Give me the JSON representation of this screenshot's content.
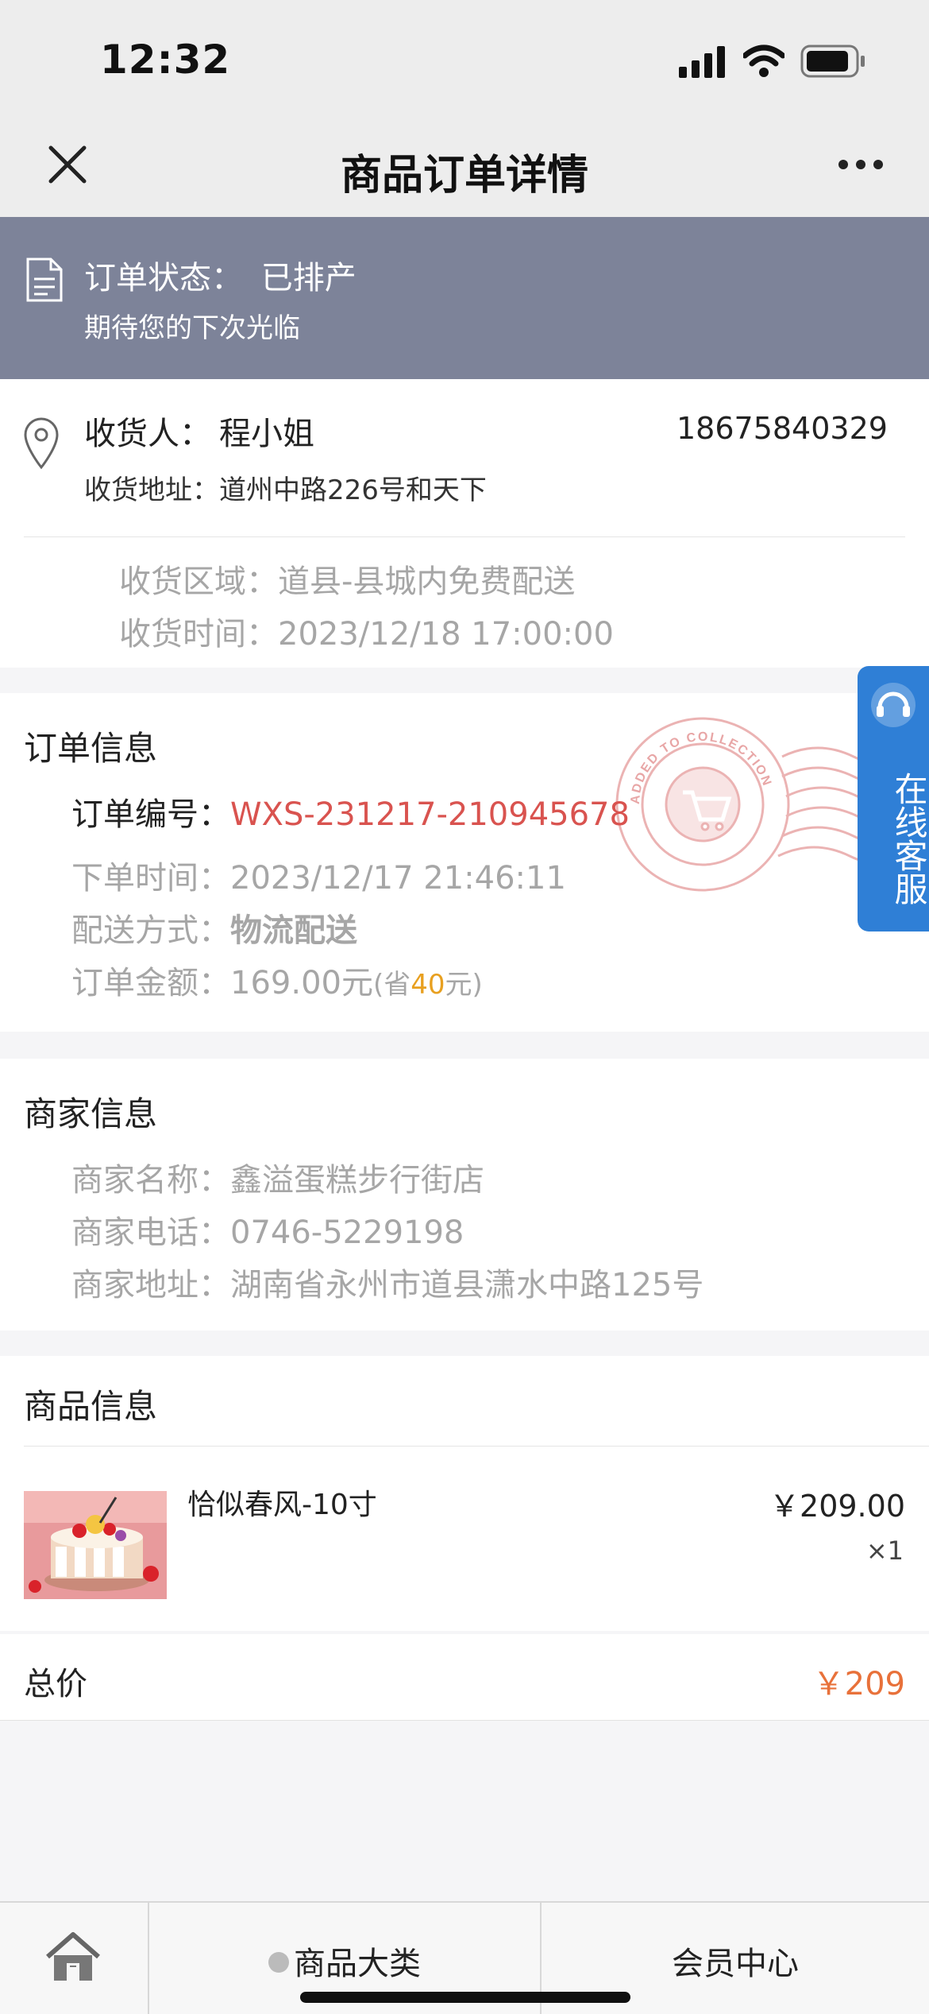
{
  "status_bar": {
    "time": "12:32"
  },
  "nav": {
    "title": "商品订单详情",
    "more": "•••"
  },
  "order_status": {
    "label": "订单状态：",
    "value": "已排产",
    "subtitle": "期待您的下次光临"
  },
  "recipient": {
    "name_label": "收货人：",
    "name": "程小姐",
    "phone": "18675840329",
    "address_label": "收货地址：",
    "address": "道州中路226号和天下",
    "area_label": "收货区域：",
    "area": "道县-县城内免费配送",
    "time_label": "收货时间：",
    "time": "2023/12/18 17:00:00"
  },
  "order_info": {
    "title": "订单信息",
    "number_label": "订单编号：",
    "number": "WXS-231217-210945678",
    "date_label": "下单时间：",
    "date": "2023/12/17 21:46:11",
    "delivery_label": "配送方式：",
    "delivery": "物流配送",
    "amount_label": "订单金额：",
    "amount": "169.00元",
    "save_prefix": "(省",
    "save_amount": "40",
    "save_suffix": "元)"
  },
  "stamp": {
    "text_top": "ADDED TO COLLECTION"
  },
  "service": {
    "label": "在线客服"
  },
  "merchant": {
    "title": "商家信息",
    "name_label": "商家名称：",
    "name": "鑫溢蛋糕步行街店",
    "phone_label": "商家电话：",
    "phone": "0746-5229198",
    "address_label": "商家地址：",
    "address": "湖南省永州市道县潇水中路125号"
  },
  "products": {
    "title": "商品信息",
    "items": [
      {
        "name": "恰似春风-10寸",
        "price": "￥209.00",
        "qty": "×1"
      }
    ]
  },
  "total": {
    "label": "总价",
    "value": "￥209"
  },
  "tabbar": {
    "category": "商品大类",
    "member": "会员中心"
  },
  "colors": {
    "banner": "#7d8399",
    "accent_red": "#d9534f",
    "accent_orange": "#e8713a",
    "service_blue": "#2f7fd6"
  },
  "icons": [
    "close-icon",
    "more-icon",
    "document-icon",
    "location-pin-icon",
    "headset-icon",
    "cart-stamp-icon",
    "home-icon",
    "dot-icon"
  ]
}
